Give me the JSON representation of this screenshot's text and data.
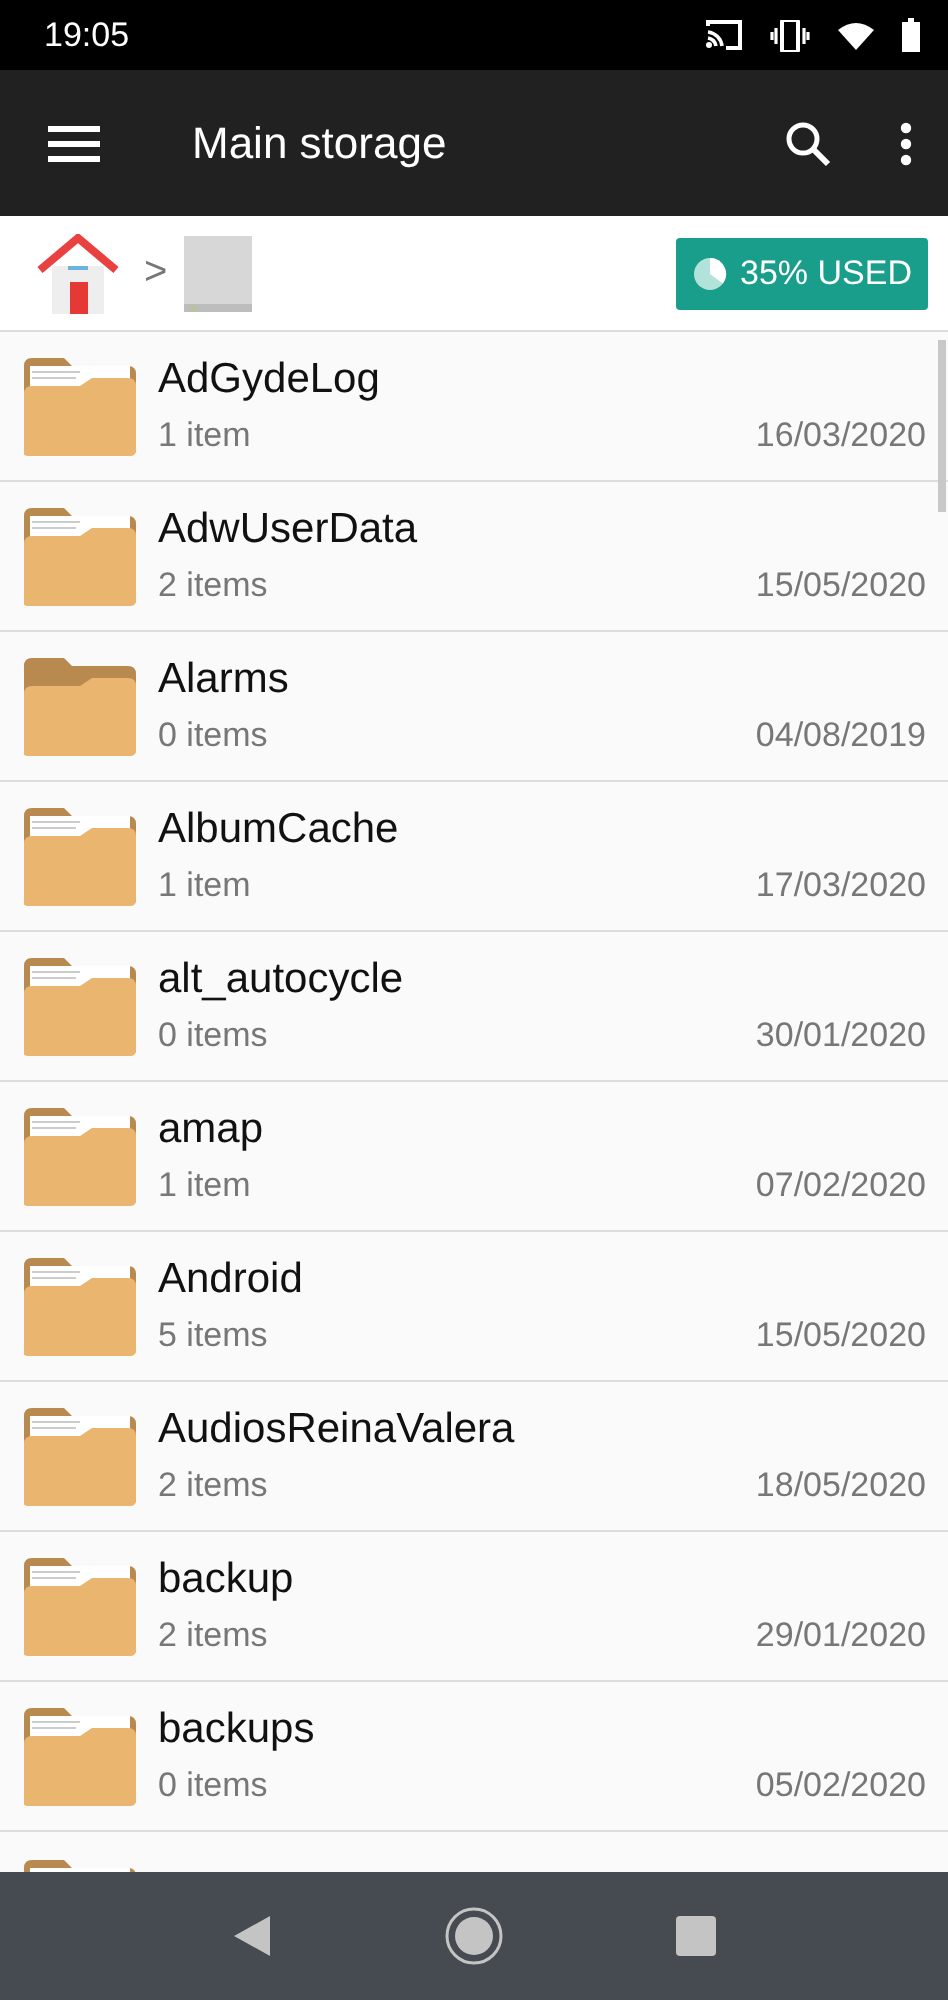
{
  "status_bar": {
    "time": "19:05"
  },
  "app_bar": {
    "title": "Main storage"
  },
  "breadcrumb": {
    "separator": ">",
    "usage": "35% USED"
  },
  "folders": [
    {
      "kind": "folder",
      "name": "AdGydeLog",
      "count": "1 item",
      "date": "16/03/2020"
    },
    {
      "kind": "folder",
      "name": "AdwUserData",
      "count": "2 items",
      "date": "15/05/2020"
    },
    {
      "kind": "empty_folder",
      "name": "Alarms",
      "count": "0 items",
      "date": "04/08/2019"
    },
    {
      "kind": "folder",
      "name": "AlbumCache",
      "count": "1 item",
      "date": "17/03/2020"
    },
    {
      "kind": "folder",
      "name": "alt_autocycle",
      "count": "0 items",
      "date": "30/01/2020"
    },
    {
      "kind": "folder",
      "name": "amap",
      "count": "1 item",
      "date": "07/02/2020"
    },
    {
      "kind": "folder",
      "name": "Android",
      "count": "5 items",
      "date": "15/05/2020"
    },
    {
      "kind": "folder",
      "name": "AudiosReinaValera",
      "count": "2 items",
      "date": "18/05/2020"
    },
    {
      "kind": "folder",
      "name": "backup",
      "count": "2 items",
      "date": "29/01/2020"
    },
    {
      "kind": "folder",
      "name": "backups",
      "count": "0 items",
      "date": "05/02/2020"
    }
  ]
}
